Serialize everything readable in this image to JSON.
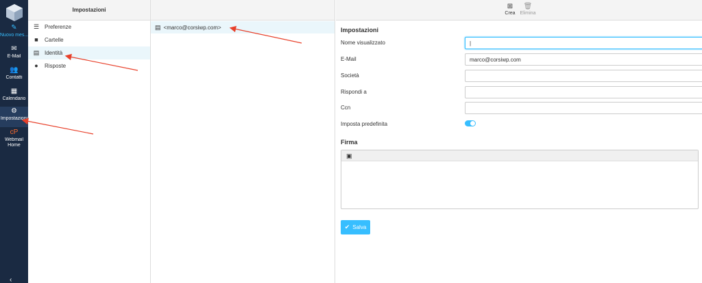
{
  "rail": {
    "items": [
      {
        "label": "Nuovo mes..."
      },
      {
        "label": "E-Mail"
      },
      {
        "label": "Contatti"
      },
      {
        "label": "Calendario"
      },
      {
        "label": "Impostazioni"
      },
      {
        "label": "Webmail\nHome"
      }
    ]
  },
  "settings": {
    "header": "Impostazioni",
    "items": [
      {
        "label": "Preferenze"
      },
      {
        "label": "Cartelle"
      },
      {
        "label": "Identità"
      },
      {
        "label": "Risposte"
      }
    ]
  },
  "identities": {
    "items": [
      {
        "label": "<marco@corsiwp.com>"
      }
    ]
  },
  "toolbar": {
    "create_label": "Crea",
    "delete_label": "Elimina"
  },
  "form": {
    "title": "Impostazioni",
    "fields": [
      {
        "label": "Nome visualizzato",
        "value": "|"
      },
      {
        "label": "E-Mail",
        "value": "marco@corsiwp.com"
      },
      {
        "label": "Società",
        "value": ""
      },
      {
        "label": "Rispondi a",
        "value": ""
      },
      {
        "label": "Ccn",
        "value": ""
      }
    ],
    "default_label": "Imposta predefinita",
    "default_on": true,
    "signature_title": "Firma",
    "save_label": "Salva"
  },
  "colors": {
    "accent": "#37beff",
    "rail_bg": "#1a2a42",
    "annotation": "#e8402a"
  }
}
